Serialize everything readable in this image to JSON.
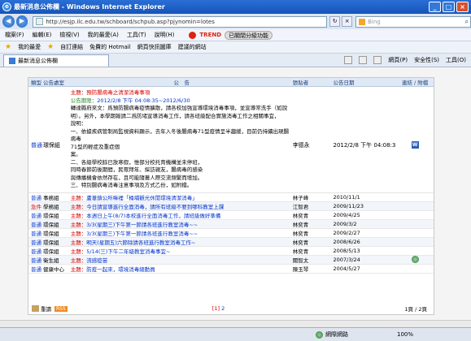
{
  "window": {
    "title": "最新消息公佈欄 - Windows Internet Explorer"
  },
  "address": {
    "url": "http://esjp.ilc.edu.tw/schboard/schpub.asp?pjynomin=lotes",
    "search_placeholder": "Bing"
  },
  "menu": {
    "items": [
      "檔案(F)",
      "編輯(E)",
      "檢視(V)",
      "我的最愛(A)",
      "工具(T)",
      "說明(H)"
    ],
    "trend_brand": "TREND",
    "trend_status": "已關閉分級功能"
  },
  "favorites": {
    "label": "我的最愛",
    "items": [
      "自訂連結",
      "免費的 Hotmail",
      "網頁快訊圖庫",
      "建議的網站"
    ]
  },
  "tab": {
    "label": "最新消息公佈欄"
  },
  "commands": [
    "網頁(P)",
    "安全性(S)",
    "工具(O)"
  ],
  "board": {
    "headers": {
      "type": "類型",
      "unit": "公告處室",
      "title": "公　告",
      "author": "張貼者",
      "date": "公告日期",
      "attach": "連結 / 附檔"
    },
    "featured": {
      "type": "普通",
      "unit": "環保組",
      "title_prefix": "主題：",
      "title": "預防腸病毒之清潔消毒事項",
      "period_label": "公告期限：",
      "period": "2012/2/8 下午 04:08:35~2012/6/30",
      "lines": [
        "轉達縣府來文：爲預防腸病毒疫情擴散，請各校加強宣導環境消毒事項，並宣導常洗手（如說",
        "明）。另外，本學期報請二爲防堵宣導消毒工作，請各班級配合實施消毒工作之相關事宜，",
        "說明：",
        "一、依據疾病管制局監視資料顯示，去年入冬後腸病毒71型疫情呈半趨緩，目前仍持續出現腸病毒",
        "71型的輕症及重症個",
        "案。",
        "二、各級學校餘已放寒假，惟部分校托育機構並未停班，",
        "同時春節前後期間，民眾拜年、探訪親友，腸病毒的感染",
        "與傳播機會依然存在，且可能隨著人際交流頻繁而增加。",
        "三、特別腸病毒消毒注意事項及方式乙份，如附檔。"
      ],
      "author": "李德永",
      "date": "2012/2/8 下午 04:08:35"
    },
    "rows": [
      {
        "type": "普通",
        "unit": "事務組",
        "title": "蘆葦鎮公所嘛裡「桶埔觀光休閒環境清潔消毒」",
        "author": "林子峰",
        "date": "2010/11/1"
      },
      {
        "type": "急件",
        "unit": "學務組",
        "title": "今日請宣導進行全面消毒，請所有班級不要到哪科教室上課",
        "author": "江智君",
        "date": "2009/11/23"
      },
      {
        "type": "普通",
        "unit": "環保組",
        "title": "本週日上午(8/7)本校進行全面消毒工作，請班級做好準備",
        "author": "林奕青",
        "date": "2009/4/25"
      },
      {
        "type": "普通",
        "unit": "環保組",
        "title": "3/3(星期三)下午第一節請各班進行教室消毒~~",
        "author": "林奕青",
        "date": "2009/3/2"
      },
      {
        "type": "普通",
        "unit": "環保組",
        "title": "3/3(星期三)下午第一節請各班進行教室消毒~~",
        "author": "林奕青",
        "date": "2009/2/27"
      },
      {
        "type": "普通",
        "unit": "環保組",
        "title": "明天(星期五)六節除請各班進行教室消毒工作~",
        "author": "林奕青",
        "date": "2008/6/26"
      },
      {
        "type": "普通",
        "unit": "環保組",
        "title": "5/14(三)下午二年級教室消毒事宜~",
        "author": "林奕青",
        "date": "2008/5/13"
      },
      {
        "type": "普通",
        "unit": "衛生組",
        "title": "流感疫苗",
        "author": "關智太",
        "date": "2007/3/24"
      },
      {
        "type": "普通",
        "unit": "健康中心",
        "title": "防疫一起來，環境消毒總動員",
        "author": "陳玉琴",
        "date": "2004/5/27"
      }
    ],
    "row_title_prefix": "主題：",
    "footer": {
      "reload": "重讀",
      "rss": "RSS",
      "page_current": "[1]",
      "page_next": "2",
      "page_count": "1頁 / 2頁"
    }
  },
  "status": {
    "zone": "網際網路",
    "zoom": "100%"
  }
}
